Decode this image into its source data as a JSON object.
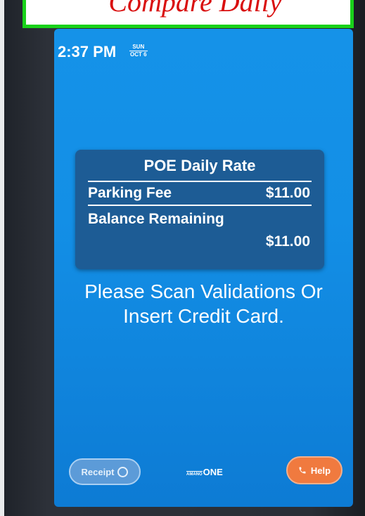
{
  "annotation": {
    "text": "Compare Daily"
  },
  "status": {
    "time": "2:37 PM",
    "day": "SUN",
    "date": "OCT 6"
  },
  "rate_card": {
    "title": "POE Daily Rate",
    "parking_fee_label": "Parking Fee",
    "parking_fee_value": "$11.00",
    "balance_label": "Balance Remaining",
    "balance_value": "$11.00"
  },
  "prompt": {
    "line1": "Please Scan Validations Or",
    "line2": "Insert Credit Card."
  },
  "footer": {
    "receipt_label": "Receipt",
    "brand_prefix": "AMANO",
    "brand_name": "ONE",
    "help_label": "Help"
  },
  "colors": {
    "screen_blue": "#1592e8",
    "card_navy": "#1d5c95",
    "help_orange": "#f07a3f",
    "annotation_green": "#19d21a",
    "annotation_red": "#d90f0f"
  },
  "icons": {
    "receipt": "circle-icon",
    "help": "phone-icon"
  }
}
